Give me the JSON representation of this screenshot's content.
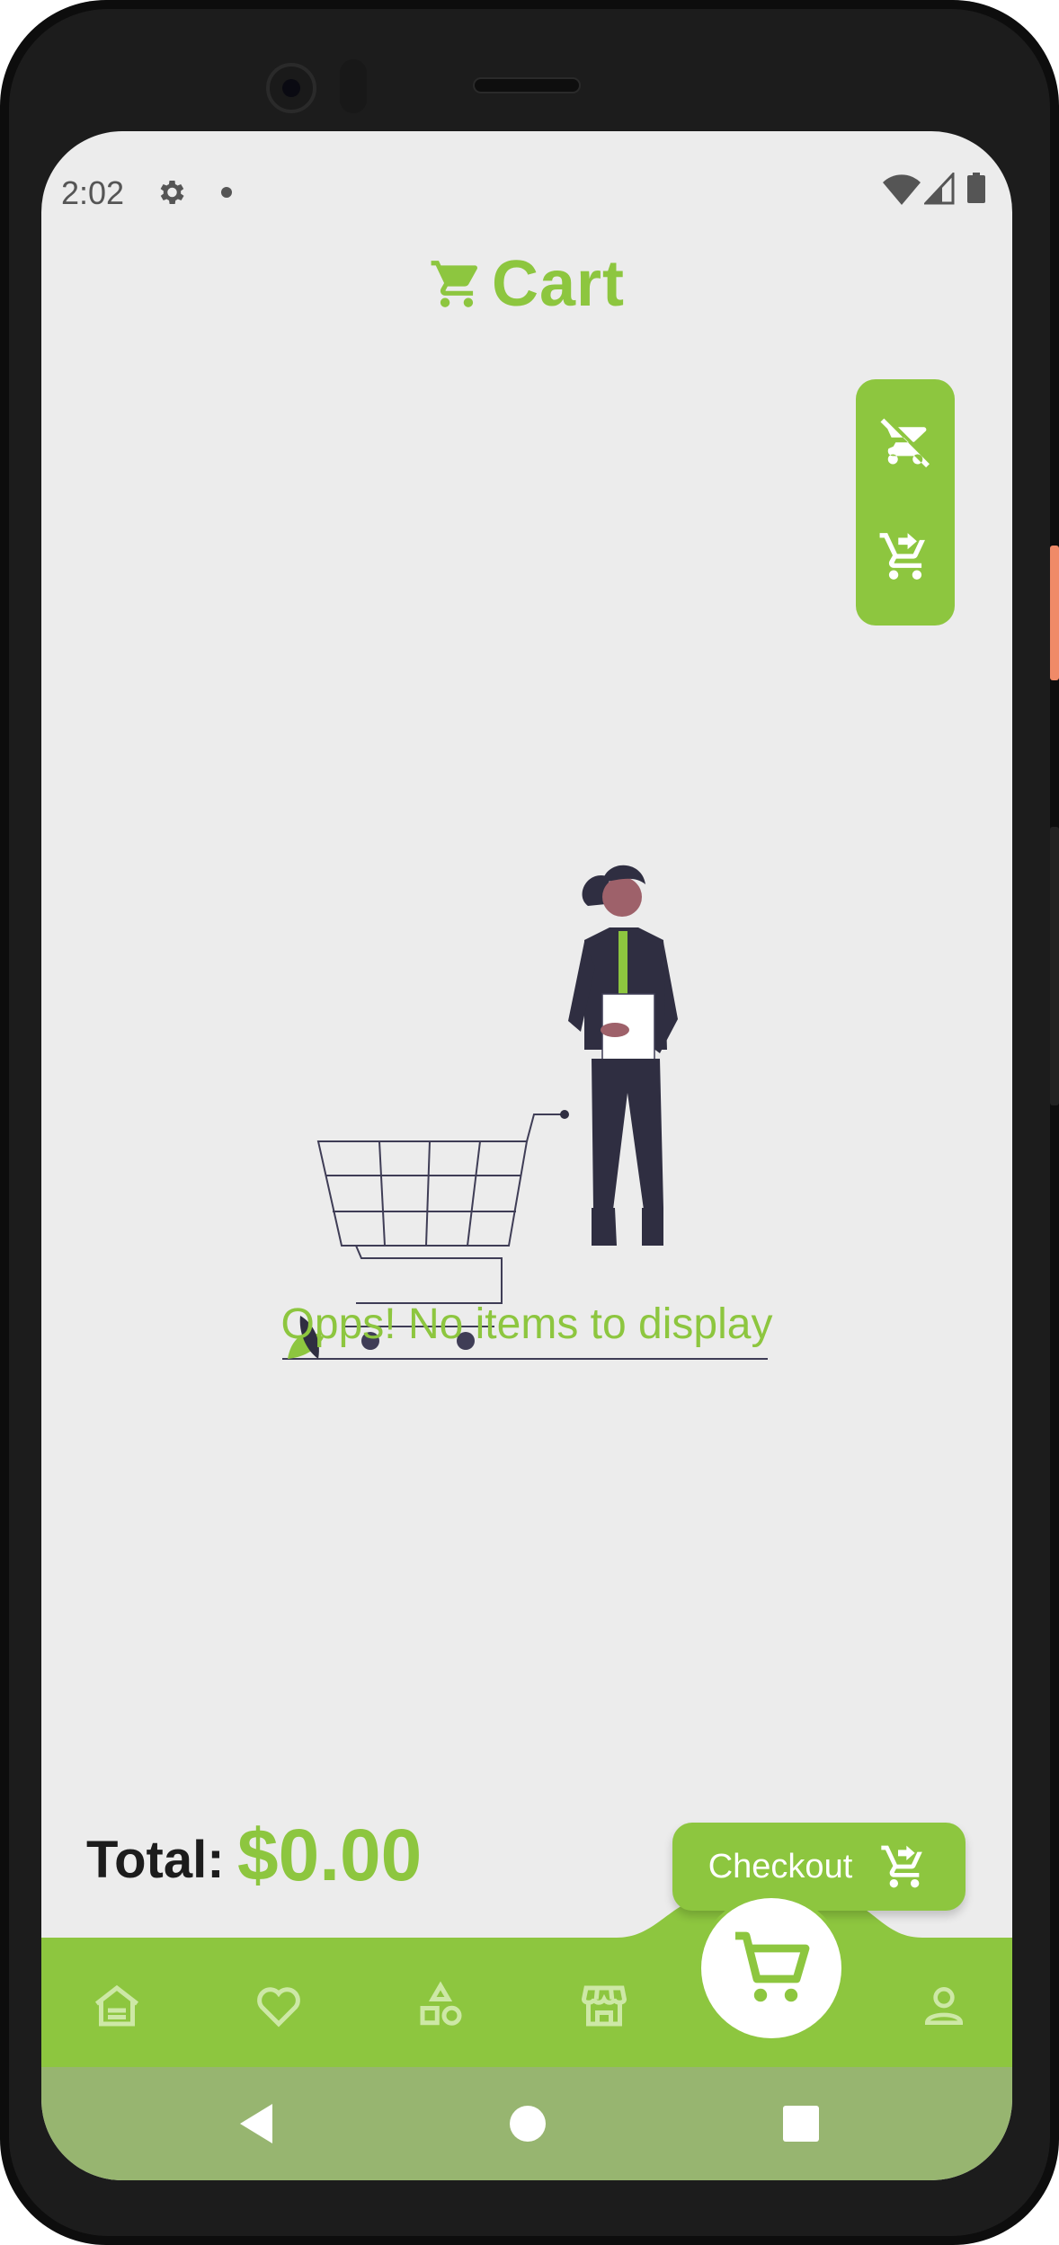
{
  "status_bar": {
    "time": "2:02",
    "icons": [
      "gear-icon",
      "notification-dot-icon",
      "wifi-icon",
      "signal-icon",
      "battery-icon"
    ]
  },
  "header": {
    "title": "Cart",
    "icon": "cart-icon"
  },
  "cart_actions": [
    {
      "icon": "clear-cart-icon"
    },
    {
      "icon": "add-to-cart-icon"
    }
  ],
  "empty_state": {
    "message": "Opps! No items to display",
    "illustration": "person-with-empty-shopping-cart"
  },
  "summary": {
    "total_label": "Total:",
    "total_value": "$0.00"
  },
  "checkout": {
    "label": "Checkout",
    "icon": "cart-arrow-icon"
  },
  "bottom_nav": {
    "items": [
      {
        "icon": "home-icon",
        "active": false
      },
      {
        "icon": "heart-icon",
        "active": false
      },
      {
        "icon": "categories-icon",
        "active": false
      },
      {
        "icon": "store-icon",
        "active": false
      },
      {
        "icon": "cart-icon",
        "active": true
      },
      {
        "icon": "profile-icon",
        "active": false
      }
    ]
  },
  "system_nav": [
    "back-icon",
    "home-circle-icon",
    "recents-icon"
  ],
  "colors": {
    "accent": "#8dc63f",
    "screen_bg": "#ececec",
    "system_nav_bg": "#97b570",
    "text_dark": "#1c1c1c",
    "illustration_dark": "#2f2e41"
  }
}
